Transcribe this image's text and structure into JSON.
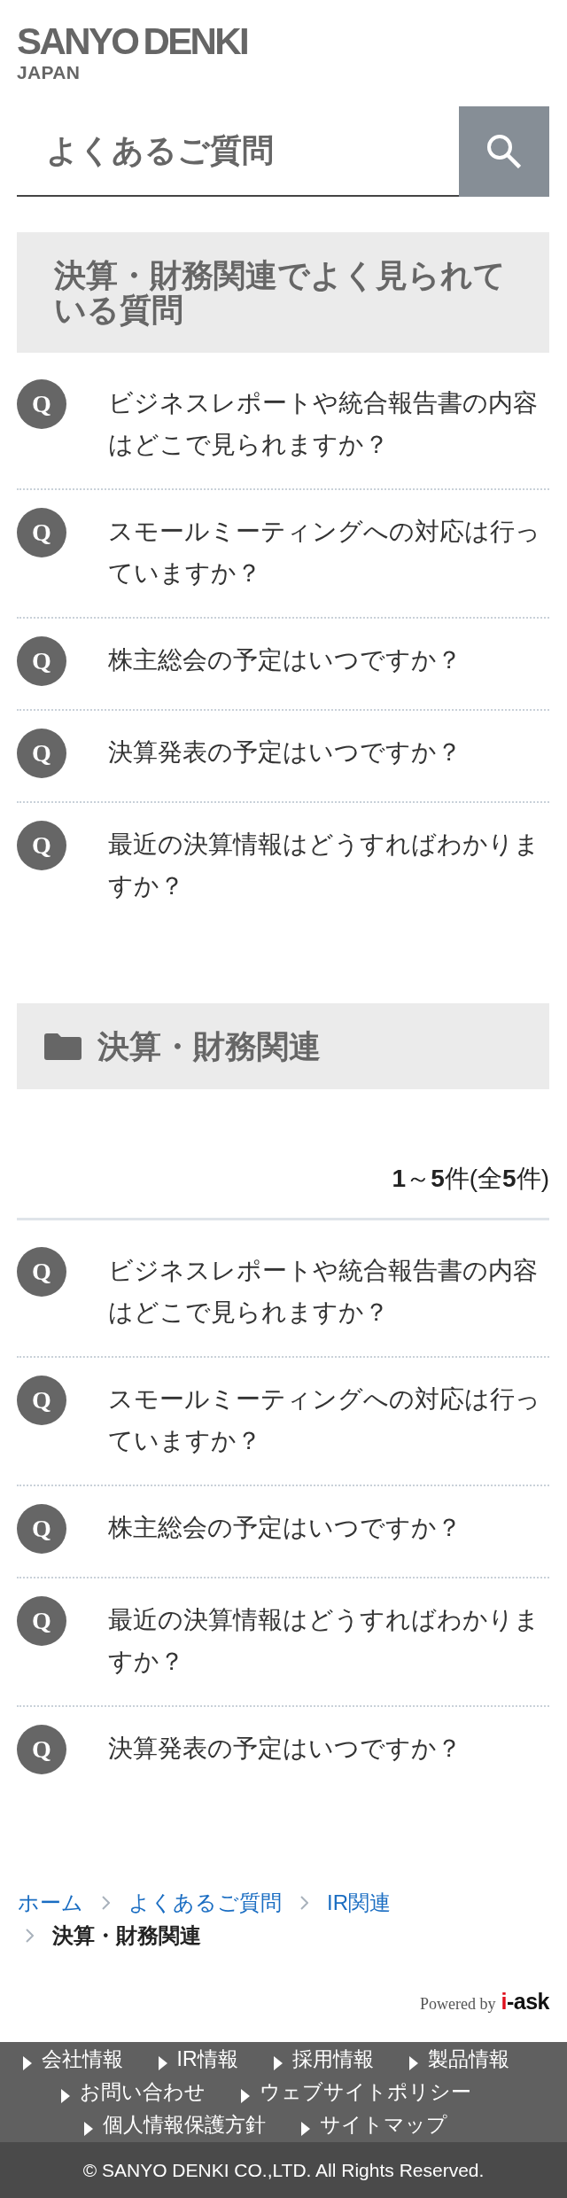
{
  "header": {
    "logo": {
      "name": "SANYO DENKI",
      "region": "JAPAN"
    },
    "page_title": "よくあるご質問"
  },
  "featured": {
    "title": "決算・財務関連でよく見られている質問",
    "questions": [
      {
        "badge": "Q",
        "text": "ビジネスレポートや統合報告書の内容はどこで見られますか？"
      },
      {
        "badge": "Q",
        "text": "スモールミーティングへの対応は行っていますか？"
      },
      {
        "badge": "Q",
        "text": "株主総会の予定はいつですか？"
      },
      {
        "badge": "Q",
        "text": "決算発表の予定はいつですか？"
      },
      {
        "badge": "Q",
        "text": "最近の決算情報はどうすればわかりますか？"
      }
    ]
  },
  "category": {
    "title": "決算・財務関連",
    "count": "**1**～**5**件(全**5**件)",
    "questions": [
      {
        "badge": "Q",
        "text": "ビジネスレポートや統合報告書の内容はどこで見られますか？"
      },
      {
        "badge": "Q",
        "text": "スモールミーティングへの対応は行っていますか？"
      },
      {
        "badge": "Q",
        "text": "株主総会の予定はいつですか？"
      },
      {
        "badge": "Q",
        "text": "最近の決算情報はどうすればわかりますか？"
      },
      {
        "badge": "Q",
        "text": "決算発表の予定はいつですか？"
      }
    ]
  },
  "breadcrumb": [
    {
      "label": "ホーム",
      "kind": "link"
    },
    {
      "label": "よくあるご質問",
      "kind": "link"
    },
    {
      "label": "IR関連",
      "kind": "link"
    },
    {
      "label": "決算・財務関連",
      "kind": "current"
    }
  ],
  "powered_by": {
    "label": "Powered by",
    "brand": "i-ask"
  },
  "footer": {
    "links": [
      "会社情報",
      "IR情報",
      "採用情報",
      "製品情報",
      "お問い合わせ",
      "ウェブサイトポリシー",
      "個人情報保護方針",
      "サイトマップ"
    ],
    "copyright": "© SANYO DENKI CO.,LTD. All Rights Reserved."
  }
}
